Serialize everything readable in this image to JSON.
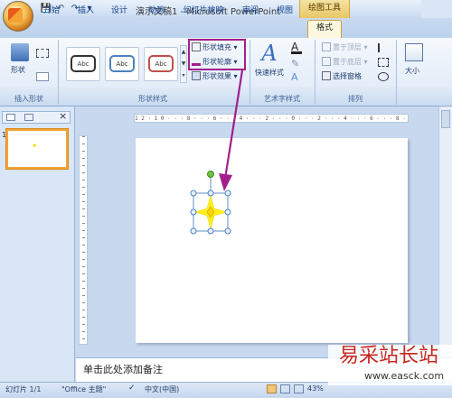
{
  "window": {
    "title": "演示文稿1 - Microsoft PowerPoint",
    "context_tab_title": "绘图工具"
  },
  "quick_access": {
    "save": "💾",
    "undo": "↶",
    "redo": "↷",
    "more": "▾"
  },
  "tabs": [
    "开始",
    "插入",
    "设计",
    "动画",
    "幻灯片放映",
    "审阅",
    "视图",
    "格式"
  ],
  "active_tab": "格式",
  "ribbon": {
    "insert_shapes": {
      "label": "插入形状",
      "shapes_button": "形状"
    },
    "shape_styles": {
      "label": "形状样式",
      "styles": [
        {
          "text": "Abc",
          "border": "#333333"
        },
        {
          "text": "Abc",
          "border": "#4f81bd"
        },
        {
          "text": "Abc",
          "border": "#c0504d"
        }
      ],
      "fill": "形状填充",
      "outline": "形状轮廓",
      "effects": "形状效果"
    },
    "wordart": {
      "label": "艺术字样式",
      "quick_styles": "快速样式"
    },
    "arrange": {
      "label": "排列",
      "bring_front": "置于顶层",
      "send_back": "置于底层",
      "selection_pane": "选择窗格"
    },
    "size": {
      "label": "大小"
    }
  },
  "panel": {
    "close": "×",
    "slide_number": "1"
  },
  "ruler": {
    "h": "1 2 · 1 0 · · · 8 · · · 6 · · · 4 · · · 2 · · · 0 · · · 2 · · · 4 · · · 6 · · · 8 · · · 1 0 · · · 1 2"
  },
  "notes": {
    "placeholder": "单击此处添加备注"
  },
  "status": {
    "slide": "幻灯片 1/1",
    "theme": "\"Office 主题\"",
    "lang": "中文(中国)",
    "zoom": "43%"
  },
  "watermark": {
    "text": "易采站长站",
    "url": "www.easck.com"
  },
  "colors": {
    "accent_arrow": "#a21f8c",
    "star": "#ffee22",
    "selection": "#5f8fc5",
    "rotate_handle": "#6cc243"
  }
}
